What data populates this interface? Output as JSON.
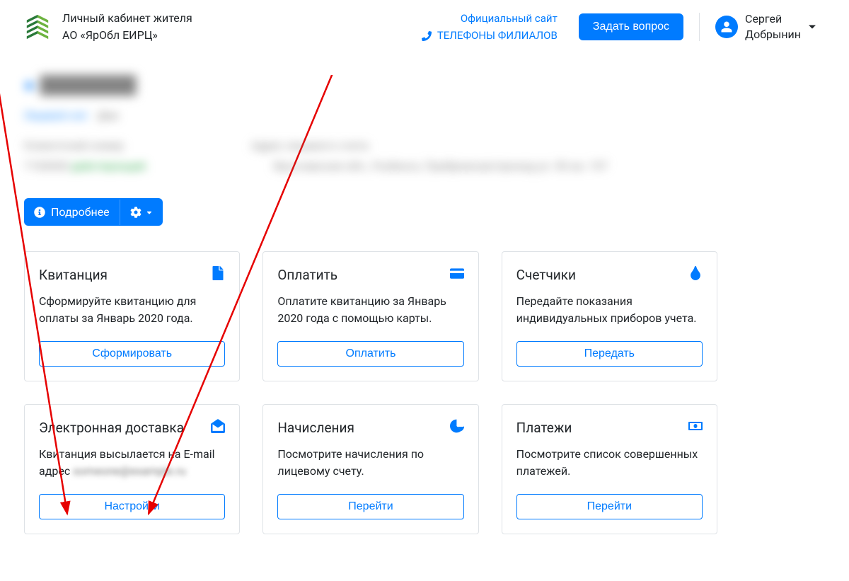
{
  "header": {
    "brand_line1": "Личный кабинет жителя",
    "brand_line2": "АО «ЯрОбл ЕИРЦ»",
    "site_link": "Официальный сайт",
    "phones_link": "ТЕЛЕФОНЫ ФИЛИАЛОВ",
    "ask_button": "Задать вопрос",
    "user_first": "Сергей",
    "user_last": "Добрынин"
  },
  "details_button": {
    "label": "Подробнее"
  },
  "cards": [
    {
      "title": "Квитанция",
      "desc": "Сформируйте квитанцию для оплаты за Январь 2020 года.",
      "button": "Сформировать"
    },
    {
      "title": "Оплатить",
      "desc": "Оплатите квитанцию за Январь 2020 года с помощью карты.",
      "button": "Оплатить"
    },
    {
      "title": "Счетчики",
      "desc": "Передайте показания индивидуальных приборов учета.",
      "button": "Передать"
    },
    {
      "title": "Электронная доставка",
      "desc_prefix": "Квитанция высылается на E-mail адрес ",
      "button": "Настройки"
    },
    {
      "title": "Начисления",
      "desc": "Посмотрите начисления по лицевому счету.",
      "button": "Перейти"
    },
    {
      "title": "Платежи",
      "desc": "Посмотрите список совершенных платежей.",
      "button": "Перейти"
    }
  ]
}
